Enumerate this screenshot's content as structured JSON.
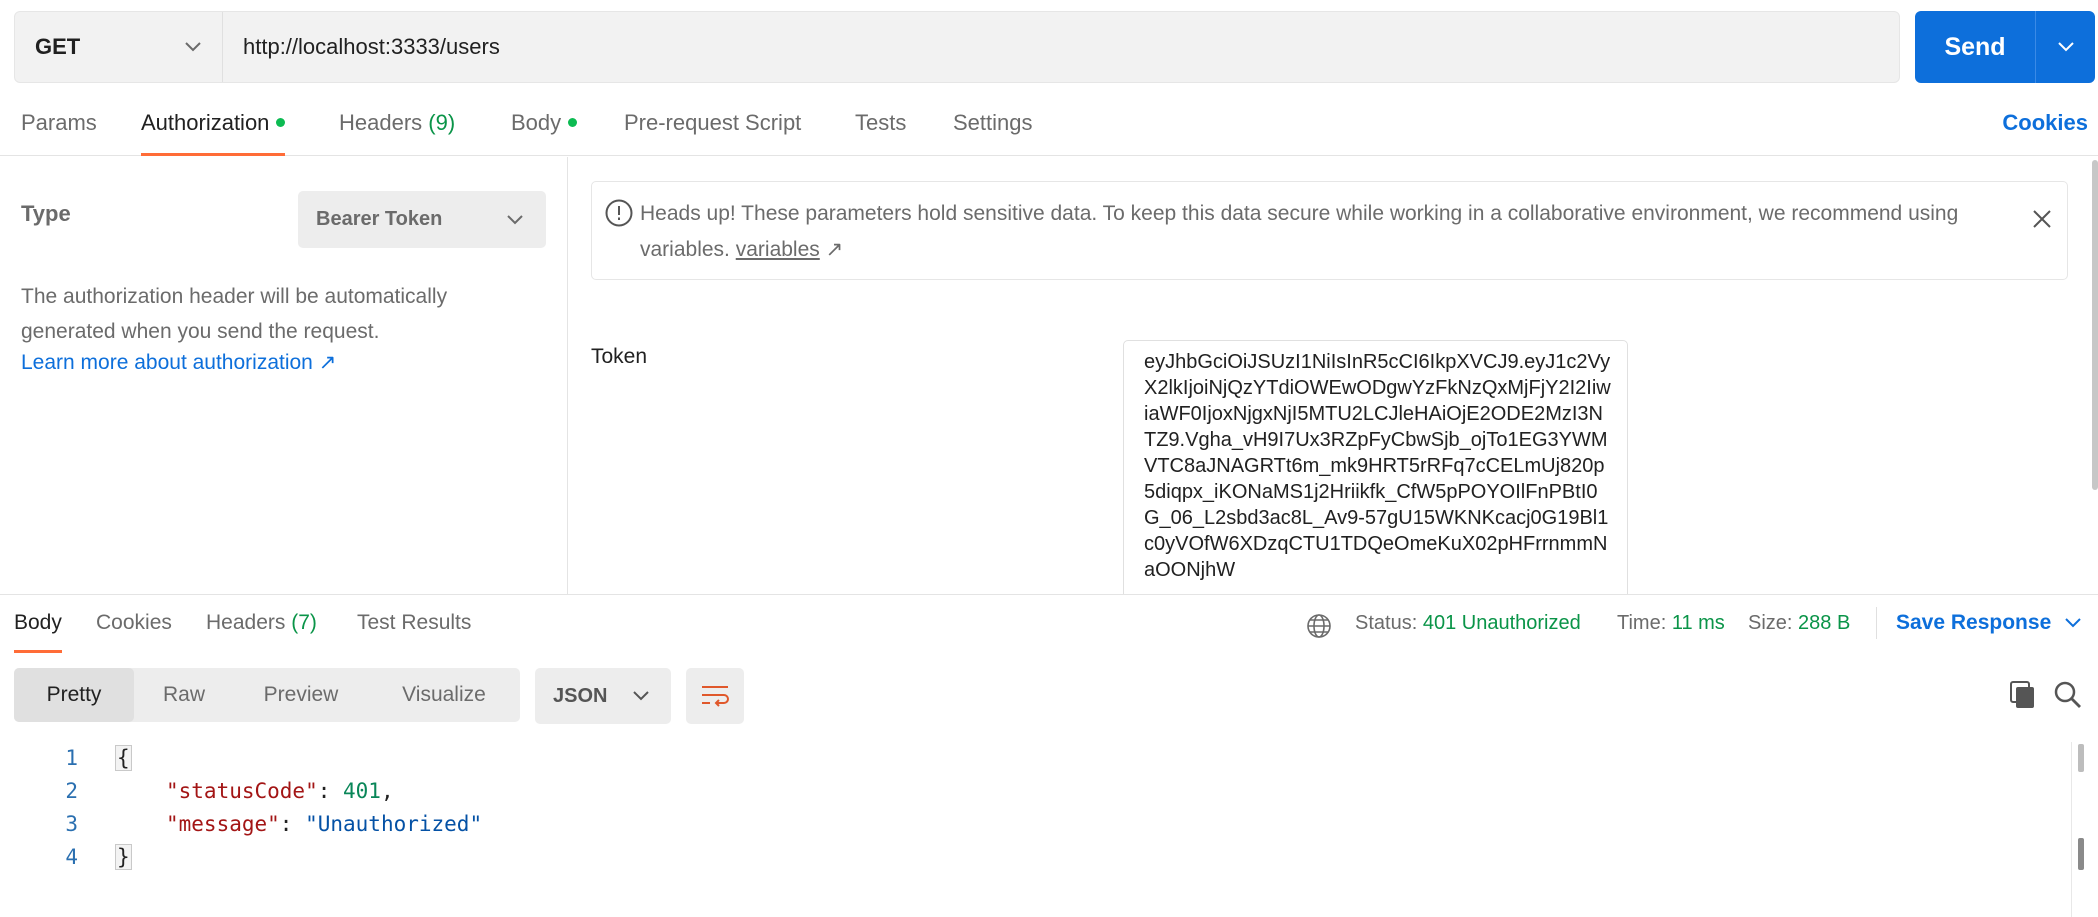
{
  "request": {
    "method": "GET",
    "url": "http://localhost:3333/users",
    "send_label": "Send"
  },
  "tabs": {
    "params": "Params",
    "authorization": "Authorization",
    "headers": "Headers",
    "headers_count": "(9)",
    "body": "Body",
    "prerequest": "Pre-request Script",
    "tests": "Tests",
    "settings": "Settings",
    "cookies": "Cookies"
  },
  "auth": {
    "type_label": "Type",
    "type_value": "Bearer Token",
    "description": "The authorization header will be automatically generated when you send the request.",
    "learn_more": "Learn more about authorization ↗",
    "banner_text": "Heads up! These parameters hold sensitive data. To keep this data secure while working in a collaborative environment, we recommend using variables.",
    "banner_link": "variables",
    "banner_link_arrow": "↗",
    "token_label": "Token",
    "token_value": "eyJhbGciOiJSUzI1NiIsInR5cCI6IkpXVCJ9.eyJ1c2VyX2lkIjoiNjQzYTdiOWEwODgwYzFkNzQxMjFjY2I2IiwiaWF0IjoxNjgxNjI5MTU2LCJleHAiOjE2ODE2MzI3NTZ9.Vgha_vH9I7Ux3RZpFyCbwSjb_ojTo1EG3YWMVTC8aJNAGRTt6m_mk9HRT5rRFq7cCELmUj820p5diqpx_iKONaMS1j2Hriikfk_CfW5pPOYOIlFnPBtI0G_06_L2sbd3ac8L_Av9-57gU15WKNKcacj0G19Bl1c0yVOfW6XDzqCTU1TDQeOmeKuX02pHFrrnmmNaOONjhW"
  },
  "response": {
    "tabs": {
      "body": "Body",
      "cookies": "Cookies",
      "headers": "Headers",
      "headers_count": "(7)",
      "test_results": "Test Results"
    },
    "status_label": "Status:",
    "status_value": "401 Unauthorized",
    "time_label": "Time:",
    "time_value": "11 ms",
    "size_label": "Size:",
    "size_value": "288 B",
    "save_label": "Save Response",
    "views": [
      "Pretty",
      "Raw",
      "Preview",
      "Visualize"
    ],
    "format": "JSON",
    "code": {
      "line_numbers": [
        "1",
        "2",
        "3",
        "4"
      ],
      "open_brace": "{",
      "close_brace": "}",
      "key1": "\"statusCode\"",
      "val1": "401",
      "key2": "\"message\"",
      "val2": "\"Unauthorized\""
    }
  },
  "colors": {
    "accent": "#0d6fdb",
    "tab_indicator": "#ff6c37",
    "success": "#0a9448",
    "dot": "#0cbb52"
  }
}
